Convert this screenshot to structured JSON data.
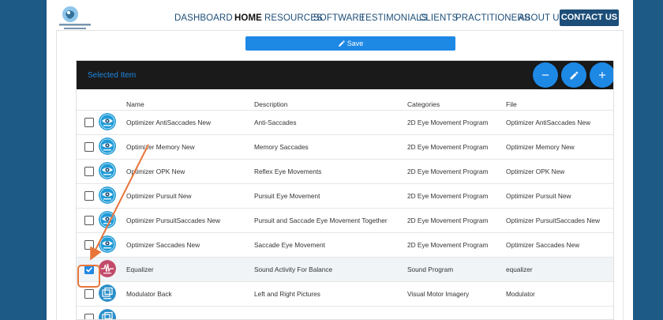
{
  "nav": {
    "logo_name": "AutonomousBrain",
    "items": [
      "DASHBOARD",
      "HOME",
      "RESOURCES",
      "SOFTWARE",
      "TESTIMONIALS",
      "CLIENTS",
      "PRACTITIONERS",
      "ABOUT US"
    ],
    "active": "HOME",
    "contact": "CONTACT US"
  },
  "save_label": "Save",
  "toolbar": {
    "title": "Selected Item"
  },
  "columns": [
    "Name",
    "Description",
    "Categories",
    "File"
  ],
  "rows": [
    {
      "name": "Optimizer AntiSaccades New",
      "description": "Anti-Saccades",
      "category": "2D Eye Movement Program",
      "file": "Optimizer AntiSaccades New",
      "icon": "eye-icon",
      "checked": false
    },
    {
      "name": "Optimizer Memory New",
      "description": "Memory Saccades",
      "category": "2D Eye Movement Program",
      "file": "Optimizer Memory New",
      "icon": "eye-icon",
      "checked": false
    },
    {
      "name": "Optimizer OPK New",
      "description": "Reflex Eye Movements",
      "category": "2D Eye Movement Program",
      "file": "Optimizer OPK New",
      "icon": "eye-icon",
      "checked": false
    },
    {
      "name": "Optimizer Pursuit New",
      "description": "Pursuit Eye Movement",
      "category": "2D Eye Movement Program",
      "file": "Optimizer Pursuit New",
      "icon": "eye-icon",
      "checked": false
    },
    {
      "name": "Optimizer PursuitSaccades New",
      "description": "Pursuit and Saccade Eye Movement Together",
      "category": "2D Eye Movement Program",
      "file": "Optimizer PursuitSaccades New",
      "icon": "eye-icon",
      "checked": false
    },
    {
      "name": "Optimizer Saccades New",
      "description": "Saccade Eye Movement",
      "category": "2D Eye Movement Program",
      "file": "Optimizer Saccades New",
      "icon": "eye-icon",
      "checked": false
    },
    {
      "name": "Equalizer",
      "description": "Sound Activity For Balance",
      "category": "Sound Program",
      "file": "equalizer",
      "icon": "sound-wave-icon",
      "checked": true
    },
    {
      "name": "Modulator Back",
      "description": "Left and Right Pictures",
      "category": "Visual Motor Imagery",
      "file": "Modulator",
      "icon": "pictures-icon",
      "checked": false
    },
    {
      "name": "",
      "description": "",
      "category": "",
      "file": "",
      "icon": "pictures-icon",
      "checked": false
    }
  ],
  "colors": {
    "accent": "#1e88e5",
    "nav": "#1d4e79",
    "annotation": "#e8743b",
    "background": "#1d5a86"
  }
}
